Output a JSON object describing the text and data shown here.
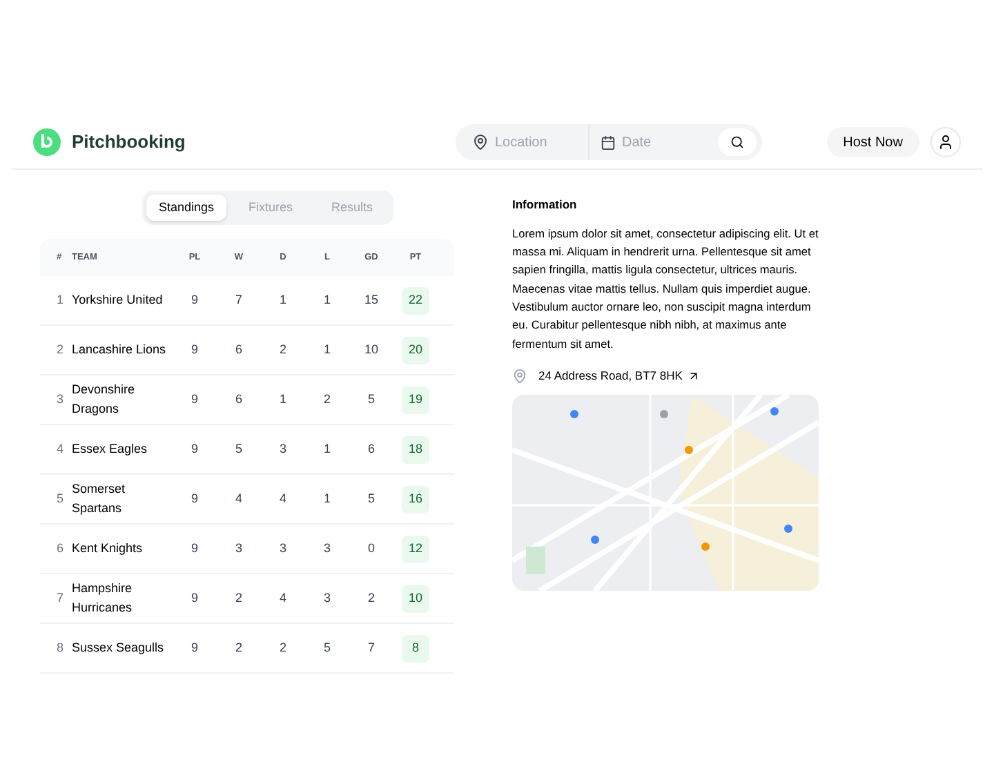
{
  "header": {
    "brand": "Pitchbooking",
    "search": {
      "location_placeholder": "Location",
      "date_placeholder": "Date"
    },
    "host_button": "Host Now"
  },
  "tabs": [
    {
      "label": "Standings",
      "selected": true
    },
    {
      "label": "Fixtures",
      "selected": false
    },
    {
      "label": "Results",
      "selected": false
    }
  ],
  "table": {
    "columns": [
      "#",
      "TEAM",
      "PL",
      "W",
      "D",
      "L",
      "GD",
      "PT"
    ],
    "rows": [
      [
        "1",
        "Yorkshire United",
        "9",
        "7",
        "1",
        "1",
        "15",
        "22"
      ],
      [
        "2",
        "Lancashire Lions",
        "9",
        "6",
        "2",
        "1",
        "10",
        "20"
      ],
      [
        "3",
        "Devonshire Dragons",
        "9",
        "6",
        "1",
        "2",
        "5",
        "19"
      ],
      [
        "4",
        "Essex Eagles",
        "9",
        "5",
        "3",
        "1",
        "6",
        "18"
      ],
      [
        "5",
        "Somerset Spartans",
        "9",
        "4",
        "4",
        "1",
        "5",
        "16"
      ],
      [
        "6",
        "Kent Knights",
        "9",
        "3",
        "3",
        "3",
        "0",
        "12"
      ],
      [
        "7",
        "Hampshire Hurricanes",
        "9",
        "2",
        "4",
        "3",
        "2",
        "10"
      ],
      [
        "8",
        "Sussex Seagulls",
        "9",
        "2",
        "2",
        "5",
        "7",
        "8"
      ]
    ]
  },
  "info": {
    "title": "Information",
    "body": "Lorem ipsum dolor sit amet, consectetur adipiscing elit. Ut et massa mi. Aliquam in hendrerit urna. Pellentesque sit amet sapien fringilla, mattis ligula consectetur, ultrices mauris. Maecenas vitae mattis tellus. Nullam quis imperdiet augue. Vestibulum auctor ornare leo, non suscipit magna interdum eu. Curabitur pellentesque nibh nibh, at maximus ante fermentum sit amet.",
    "address": "24 Address Road, BT7 8HK"
  }
}
